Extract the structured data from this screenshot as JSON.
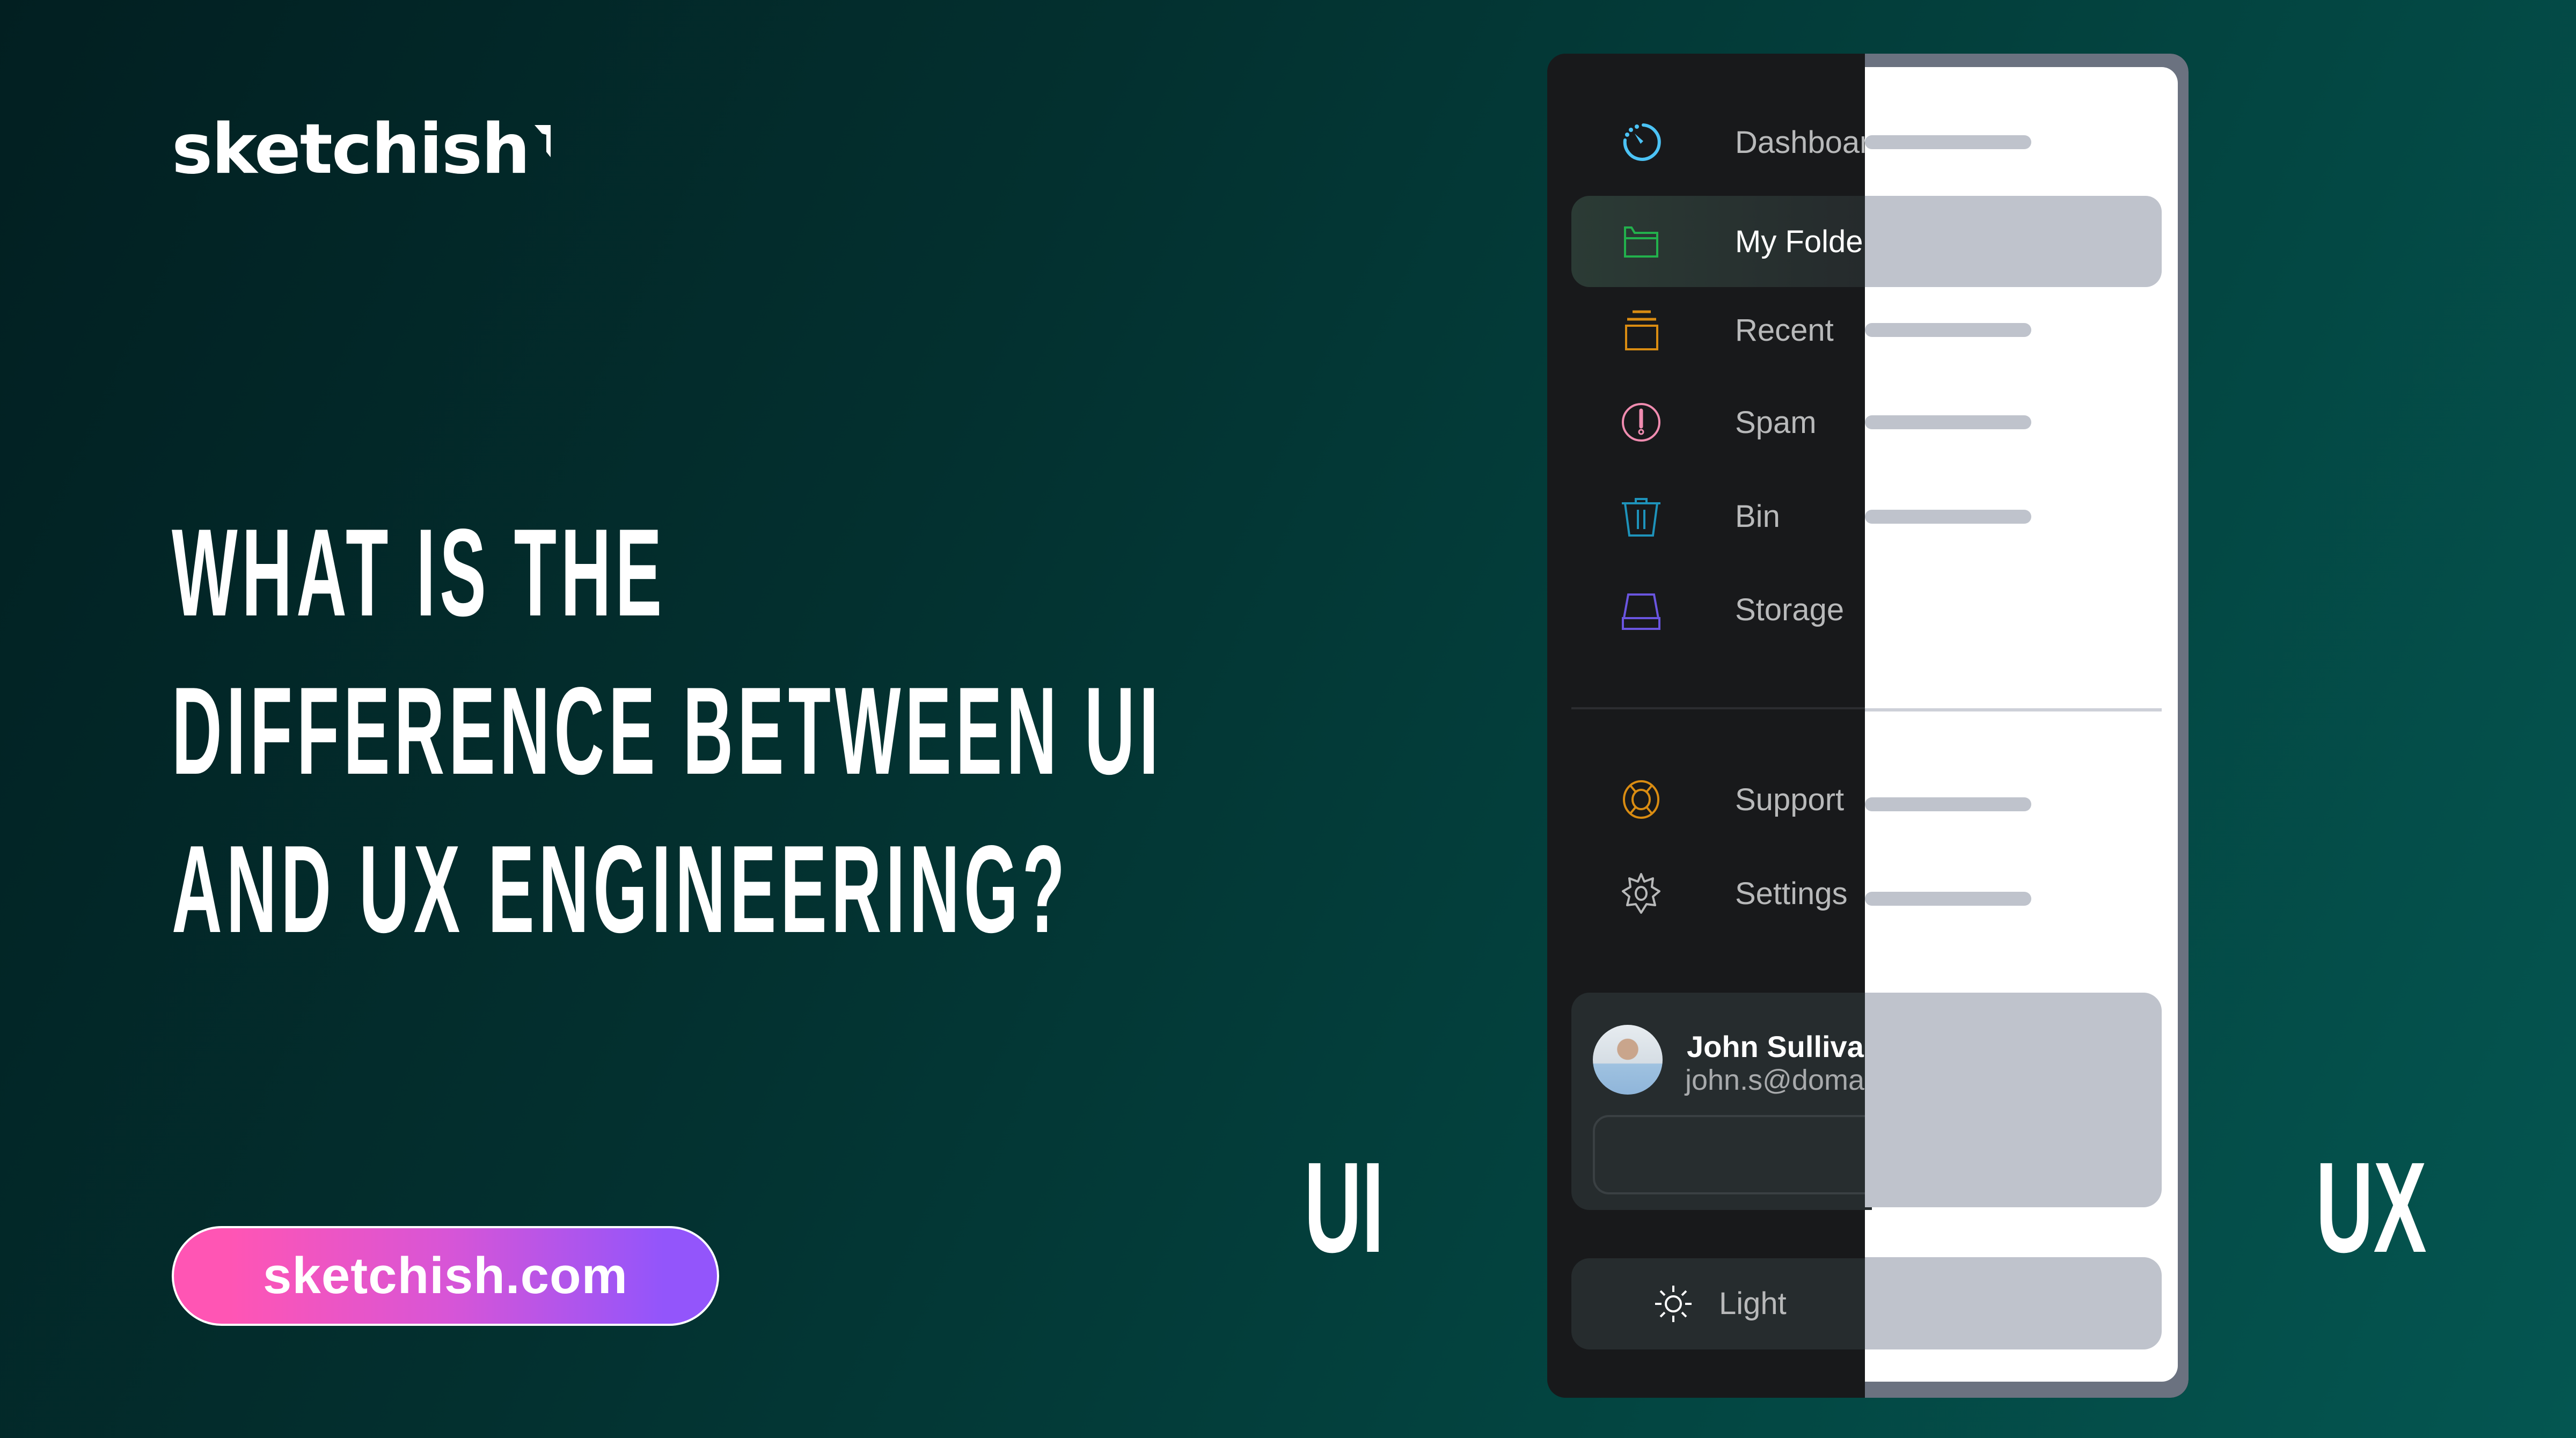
{
  "brand": {
    "logo_text": "sketchish",
    "cta_label": "sketchish.com"
  },
  "headline": {
    "lines": [
      "WHAT IS THE",
      "DIFFERENCE BETWEEN UI",
      "AND UX ENGINEERING?"
    ]
  },
  "labels": {
    "ui": "UI",
    "ux": "UX"
  },
  "colors": {
    "background": "#03302f",
    "panel_dark": "#18191b",
    "panel_light": "#ffffff",
    "placeholder_gray": "#bfc3cc",
    "cta_start": "#ff55b4",
    "cta_end": "#9355fb"
  },
  "sidebar": {
    "items": [
      {
        "label": "Dashboard",
        "icon": "dashboard-gauge-icon",
        "color": "#4cc3f5",
        "active": false
      },
      {
        "label": "My Folder",
        "icon": "folder-icon",
        "color": "#22b14c",
        "active": true
      },
      {
        "label": "Recent",
        "icon": "recent-stack-icon",
        "color": "#d98c12",
        "active": false
      },
      {
        "label": "Spam",
        "icon": "alert-circle-icon",
        "color": "#f08cb0",
        "active": false
      },
      {
        "label": "Bin",
        "icon": "trash-icon",
        "color": "#1e93bb",
        "active": false
      },
      {
        "label": "Storage",
        "icon": "storage-drive-icon",
        "color": "#6a55e0",
        "active": false
      }
    ],
    "footer_items": [
      {
        "label": "Support",
        "icon": "lifebuoy-icon",
        "color": "#d98c12"
      },
      {
        "label": "Settings",
        "icon": "gear-icon",
        "color": "#b8b9ba"
      }
    ],
    "user": {
      "name": "John Sullivan",
      "name_visible": "John Sulliva",
      "email_visible": "john.s@doma"
    },
    "theme_toggle": {
      "label": "Light",
      "icon": "sun-icon"
    }
  }
}
